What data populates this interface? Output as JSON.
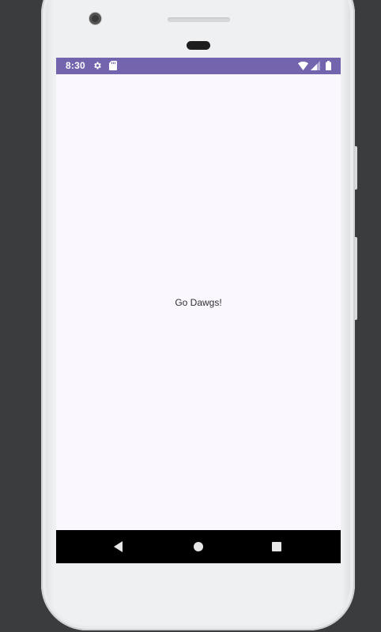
{
  "status_bar": {
    "time": "8:30",
    "background_color": "#7364ad",
    "left_icons": [
      "gear-icon",
      "sd-card-icon"
    ],
    "right_icons": [
      "wifi-icon",
      "cell-signal-icon",
      "battery-icon"
    ]
  },
  "content": {
    "text": "Go Dawgs!",
    "background_color": "#fbf7fe"
  },
  "nav_bar": {
    "buttons": [
      "back-icon",
      "home-icon",
      "recents-icon"
    ],
    "background_color": "#000000"
  }
}
